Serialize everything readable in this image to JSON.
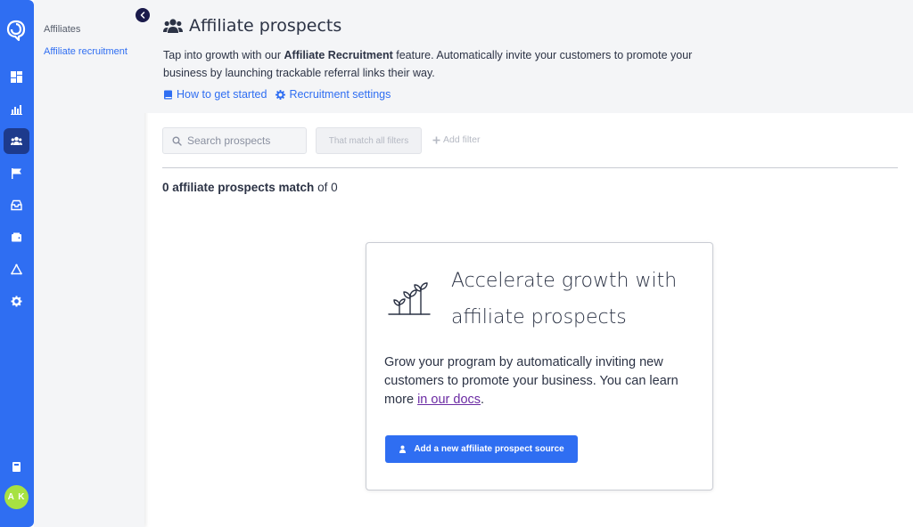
{
  "rail": {
    "icons": [
      "logo-icon",
      "dashboard-icon",
      "reports-icon",
      "affiliates-icon",
      "campaigns-icon",
      "inbox-icon",
      "payouts-icon",
      "integrations-icon",
      "settings-icon",
      "notes-icon"
    ],
    "active": "affiliates-icon",
    "avatar_initials": "A K"
  },
  "subnav": {
    "heading": "Affiliates",
    "items": [
      {
        "label": "Affiliate recruitment",
        "active": true
      }
    ]
  },
  "header": {
    "title": "Affiliate prospects",
    "description_prefix": "Tap into growth with our ",
    "description_bold": "Affiliate Recruitment",
    "description_suffix": " feature. Automatically invite your customers to promote your business by launching trackable referral links their way.",
    "links": [
      {
        "label": "How to get started",
        "icon": "book-icon"
      },
      {
        "label": "Recruitment settings",
        "icon": "gear-icon"
      }
    ]
  },
  "filters": {
    "search_placeholder": "Search prospects",
    "match_label": "That match all filters",
    "add_filter_label": "Add filter"
  },
  "results": {
    "count_bold": "0 affiliate prospects match",
    "count_suffix": " of 0"
  },
  "empty_state": {
    "headline": "Accelerate growth with affiliate prospects",
    "body_prefix": "Grow your program by automatically inviting new customers to promote your business. You can learn more ",
    "body_link": "in our docs",
    "body_suffix": ".",
    "cta_label": "Add a new affiliate prospect source"
  },
  "colors": {
    "accent": "#2f6ef2",
    "rail_active": "#1d3a8c",
    "avatar": "#a7e241",
    "link_visited": "#6b2ba3"
  }
}
